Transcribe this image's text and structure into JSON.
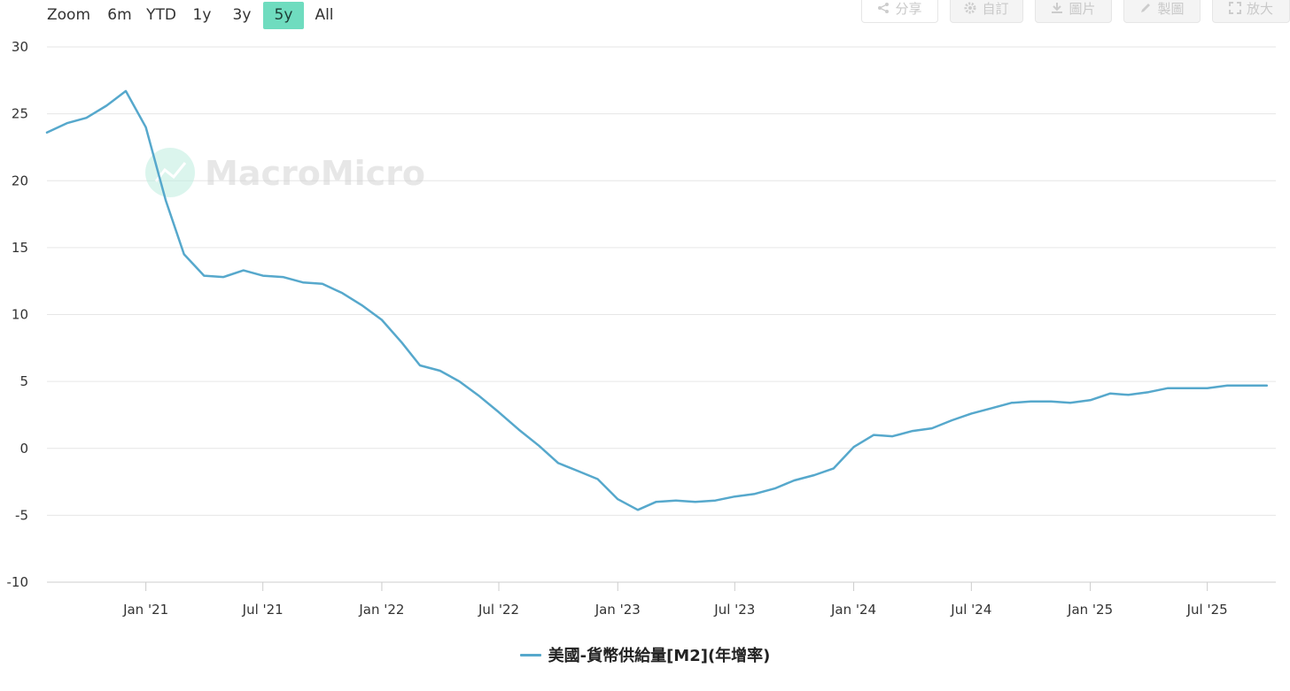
{
  "zoom": {
    "label": "Zoom",
    "buttons": [
      {
        "label": "6m",
        "active": false
      },
      {
        "label": "YTD",
        "active": false
      },
      {
        "label": "1y",
        "active": false
      },
      {
        "label": "3y",
        "active": false
      },
      {
        "label": "5y",
        "active": true
      },
      {
        "label": "All",
        "active": false
      }
    ]
  },
  "toolbar": {
    "buttons": [
      {
        "label": "分享",
        "icon": "share-icon"
      },
      {
        "label": "自訂",
        "icon": "gear-icon"
      },
      {
        "label": "圖片",
        "icon": "download-icon"
      },
      {
        "label": "製圖",
        "icon": "pencil-icon"
      },
      {
        "label": "放大",
        "icon": "expand-icon"
      }
    ]
  },
  "watermark": "MacroMicro",
  "colors": {
    "series": "#56a8cc",
    "grid": "#e6e6e6",
    "active_zoom": "#6fdcbf"
  },
  "chart_data": {
    "type": "line",
    "title": "",
    "xlabel": "",
    "ylabel": "",
    "ylim": [
      -10,
      30
    ],
    "yticks": [
      -10,
      -5,
      0,
      5,
      10,
      15,
      20,
      25,
      30
    ],
    "xlim": [
      "2020-08-01",
      "2025-10-15"
    ],
    "xticks": [
      {
        "date": "2021-01-01",
        "label": "Jan '21"
      },
      {
        "date": "2021-07-01",
        "label": "Jul '21"
      },
      {
        "date": "2022-01-01",
        "label": "Jan '22"
      },
      {
        "date": "2022-07-01",
        "label": "Jul '22"
      },
      {
        "date": "2023-01-01",
        "label": "Jan '23"
      },
      {
        "date": "2023-07-01",
        "label": "Jul '23"
      },
      {
        "date": "2024-01-01",
        "label": "Jan '24"
      },
      {
        "date": "2024-07-01",
        "label": "Jul '24"
      },
      {
        "date": "2025-01-01",
        "label": "Jan '25"
      },
      {
        "date": "2025-07-01",
        "label": "Jul '25"
      }
    ],
    "grid": true,
    "legend": "bottom-center",
    "series": [
      {
        "name": "美國-貨幣供給量[M2](年增率)",
        "x": [
          "2020-08-01",
          "2020-09-01",
          "2020-10-01",
          "2020-11-01",
          "2020-12-01",
          "2021-01-01",
          "2021-02-01",
          "2021-03-01",
          "2021-04-01",
          "2021-05-01",
          "2021-06-01",
          "2021-07-01",
          "2021-08-01",
          "2021-09-01",
          "2021-10-01",
          "2021-11-01",
          "2021-12-01",
          "2022-01-01",
          "2022-02-01",
          "2022-03-01",
          "2022-04-01",
          "2022-05-01",
          "2022-06-01",
          "2022-07-01",
          "2022-08-01",
          "2022-09-01",
          "2022-10-01",
          "2022-11-01",
          "2022-12-01",
          "2023-01-01",
          "2023-02-01",
          "2023-03-01",
          "2023-04-01",
          "2023-05-01",
          "2023-06-01",
          "2023-07-01",
          "2023-08-01",
          "2023-09-01",
          "2023-10-01",
          "2023-11-01",
          "2023-12-01",
          "2024-01-01",
          "2024-02-01",
          "2024-03-01",
          "2024-04-01",
          "2024-05-01",
          "2024-06-01",
          "2024-07-01",
          "2024-08-01",
          "2024-09-01",
          "2024-10-01",
          "2024-11-01",
          "2024-12-01",
          "2025-01-01",
          "2025-02-01",
          "2025-03-01",
          "2025-04-01",
          "2025-05-01",
          "2025-06-01",
          "2025-07-01",
          "2025-08-01",
          "2025-09-01",
          "2025-10-01"
        ],
        "values": [
          23.6,
          24.3,
          24.7,
          25.6,
          26.7,
          24.0,
          18.5,
          14.5,
          12.9,
          12.8,
          13.3,
          12.9,
          12.8,
          12.4,
          12.3,
          11.6,
          10.7,
          9.6,
          7.9,
          6.2,
          5.8,
          5.0,
          3.9,
          2.7,
          1.4,
          0.2,
          -1.1,
          -1.7,
          -2.3,
          -3.8,
          -4.6,
          -4.0,
          -3.9,
          -4.0,
          -3.9,
          -3.6,
          -3.4,
          -3.0,
          -2.4,
          -2.0,
          -1.5,
          0.1,
          1.0,
          0.9,
          1.3,
          1.5,
          2.1,
          2.6,
          3.0,
          3.4,
          3.5,
          3.5,
          3.4,
          3.6,
          4.1,
          4.0,
          4.2,
          4.5,
          4.5,
          4.5,
          4.7,
          4.7,
          4.7
        ]
      }
    ]
  }
}
